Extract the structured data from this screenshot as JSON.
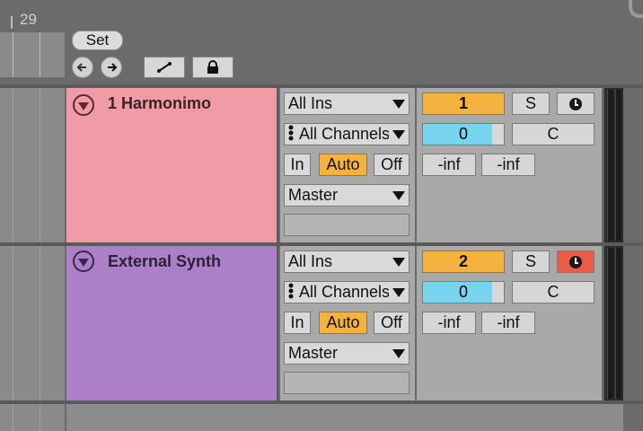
{
  "ruler": {
    "bar_number": "29"
  },
  "set_button": {
    "label": "Set"
  },
  "nav": {
    "back_icon": "arrow-left-icon",
    "forward_icon": "arrow-right-icon"
  },
  "tools": {
    "automation_icon": "automation-draw-icon",
    "lock_icon": "lock-icon"
  },
  "colors": {
    "accent_orange": "#f5b23d",
    "volume_blue": "#78d4ef",
    "track1_color": "#f19ba6",
    "track2_color": "#ad7fc6",
    "arm_red": "#ec5b47"
  },
  "tracks": [
    {
      "name": "1 Harmonimo",
      "input_type": "All Ins",
      "input_channel": "All Channels",
      "monitor": {
        "in": "In",
        "auto": "Auto",
        "off": "Off",
        "selected": "Auto"
      },
      "output": "Master",
      "number": "1",
      "solo": "S",
      "volume": "0",
      "pan": "C",
      "peak_left": "-inf",
      "peak_right": "-inf",
      "armed": false,
      "volume_fraction": 0.85
    },
    {
      "name": "External Synth",
      "input_type": "All Ins",
      "input_channel": "All Channels",
      "monitor": {
        "in": "In",
        "auto": "Auto",
        "off": "Off",
        "selected": "Auto"
      },
      "output": "Master",
      "number": "2",
      "solo": "S",
      "volume": "0",
      "pan": "C",
      "peak_left": "-inf",
      "peak_right": "-inf",
      "armed": true,
      "volume_fraction": 0.85
    }
  ]
}
